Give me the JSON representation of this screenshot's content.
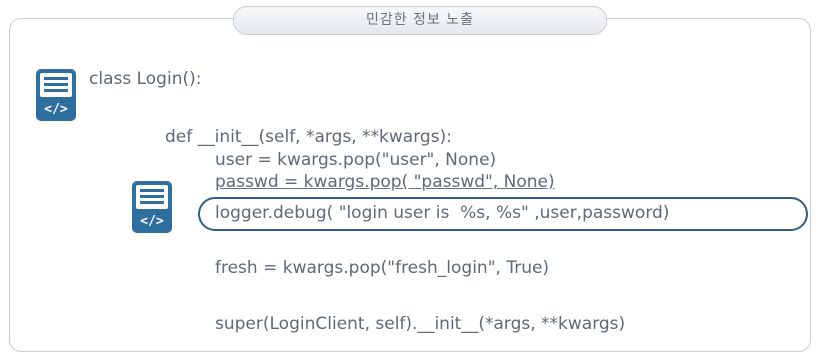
{
  "title": "민감한 정보 노출",
  "code": {
    "lines": [
      "class Login():",
      "def __init__(self, *args, **kwargs):",
      "user = kwargs.pop(\"user\", None)",
      "passwd = kwargs.pop( \"passwd\", None)",
      "logger.debug( \"login user is  %s, %s\" ,user,password)",
      "fresh = kwargs.pop(\"fresh_login\", True)",
      "super(LoginClient, self).__init__(*args, **kwargs)"
    ]
  },
  "icons": {
    "top": "code-document-icon",
    "middle": "code-document-icon",
    "glyph": "</>"
  },
  "colors": {
    "icon_blue": "#2f6f9f",
    "highlight_border": "#2f5f86",
    "text": "#5f6973"
  }
}
